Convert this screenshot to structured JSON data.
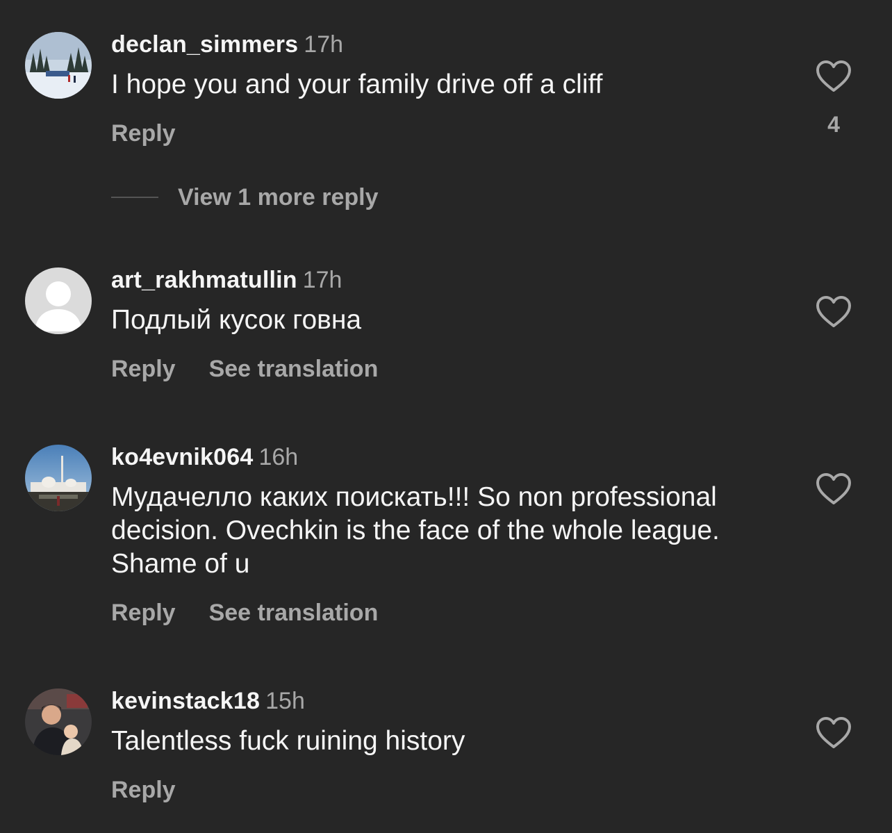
{
  "comments": [
    {
      "username": "declan_simmers",
      "time": "17h",
      "text": "I hope you and your family drive off a cliff",
      "reply_label": "Reply",
      "like_count": "4",
      "more_replies_label": "View 1 more reply"
    },
    {
      "username": "art_rakhmatullin",
      "time": "17h",
      "text": "Подлый кусок говна",
      "reply_label": "Reply",
      "translation_label": "See translation"
    },
    {
      "username": "ko4evnik064",
      "time": "16h",
      "text": "Мудачелло каких поискать!!! So non professional decision. Ovechkin is the face of the whole league. Shame of u",
      "reply_label": "Reply",
      "translation_label": "See translation"
    },
    {
      "username": "kevinstack18",
      "time": "15h",
      "text": "Talentless fuck ruining history",
      "reply_label": "Reply"
    }
  ],
  "icons": {
    "like": "heart-outline-icon",
    "default_avatar": "default-avatar-icon"
  },
  "colors": {
    "background": "#262626",
    "primary_text": "#f5f5f5",
    "secondary_text": "#a8a8a8"
  }
}
